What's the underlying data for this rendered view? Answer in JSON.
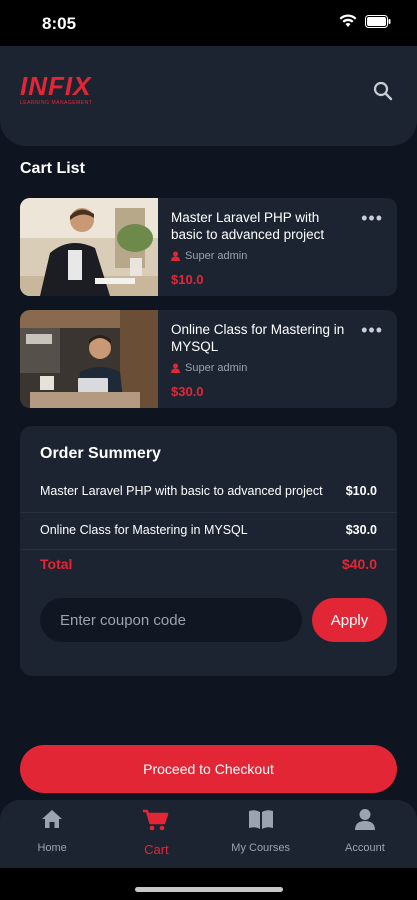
{
  "status_bar": {
    "time": "8:05"
  },
  "app": {
    "logo_main": "INFIX",
    "logo_sub": "LEARNING MANAGEMENT",
    "search_icon": "search-icon"
  },
  "cart": {
    "title": "Cart List",
    "items": [
      {
        "title": "Master Laravel PHP with basic to advanced project",
        "author": "Super admin",
        "price": "$10.0"
      },
      {
        "title": "Online Class for Mastering in MYSQL",
        "author": "Super admin",
        "price": "$30.0"
      }
    ]
  },
  "summary": {
    "title": "Order Summery",
    "rows": [
      {
        "name": "Master Laravel PHP with basic to advanced project",
        "price": "$10.0"
      },
      {
        "name": "Online Class for Mastering in MYSQL",
        "price": "$30.0"
      }
    ],
    "total_label": "Total",
    "total_value": "$40.0",
    "coupon_placeholder": "Enter coupon code",
    "apply_label": "Apply"
  },
  "checkout_label": "Proceed to Checkout",
  "nav": {
    "items": [
      {
        "label": "Home",
        "icon": "home-icon"
      },
      {
        "label": "Cart",
        "icon": "cart-icon"
      },
      {
        "label": "My Courses",
        "icon": "book-icon"
      },
      {
        "label": "Account",
        "icon": "user-icon"
      }
    ],
    "active": "Cart"
  },
  "colors": {
    "accent": "#e32636",
    "card": "#1c2432",
    "background": "#0f1520"
  }
}
